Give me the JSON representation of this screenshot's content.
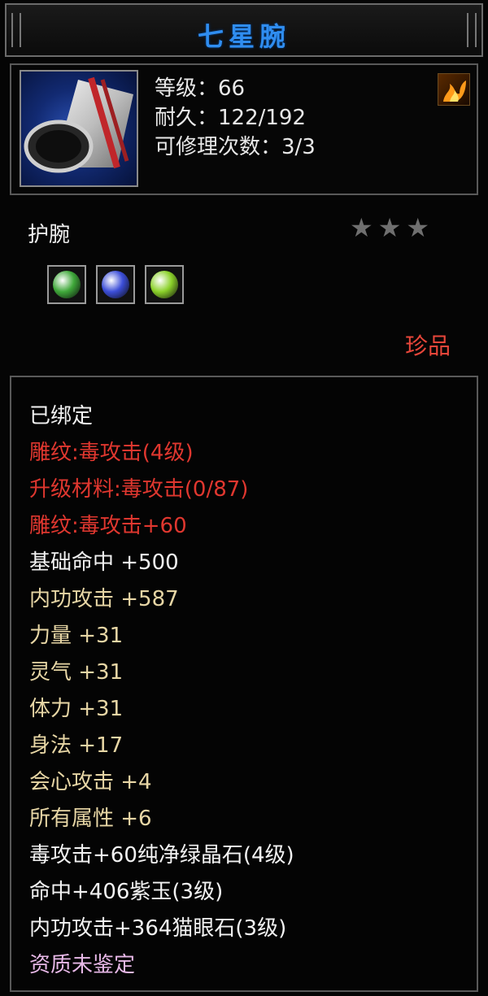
{
  "item": {
    "name": "七星腕",
    "level": "等级：66",
    "durability": "耐久：122/192",
    "repair": "可修理次数：3/3",
    "type": "护腕",
    "quality": "珍品",
    "stars": [
      "★",
      "★",
      "★"
    ],
    "stars_filled": 0,
    "stars_total": 3,
    "gem_colors": [
      "#3fa83a",
      "#3c4ed8",
      "#8bd12a"
    ]
  },
  "attributes": [
    {
      "text": "已绑定",
      "color": "#f2f2f2"
    },
    {
      "text": "雕纹:毒攻击(4级)",
      "color": "#e0372f"
    },
    {
      "text": "升级材料:毒攻击(0/87)",
      "color": "#e0372f"
    },
    {
      "text": "雕纹:毒攻击+60",
      "color": "#e0372f"
    },
    {
      "text": "基础命中 +500",
      "color": "#f2f2f2"
    },
    {
      "text": "内功攻击 +587",
      "color": "#e7d6a5"
    },
    {
      "text": "力量 +31",
      "color": "#e7d6a5"
    },
    {
      "text": "灵气 +31",
      "color": "#e7d6a5"
    },
    {
      "text": "体力 +31",
      "color": "#e7d6a5"
    },
    {
      "text": "身法 +17",
      "color": "#e7d6a5"
    },
    {
      "text": "会心攻击 +4",
      "color": "#e7d6a5"
    },
    {
      "text": "所有属性 +6",
      "color": "#e7d6a5"
    },
    {
      "text": "毒攻击+60纯净绿晶石(4级)",
      "color": "#f2f2f2"
    },
    {
      "text": "命中+406紫玉(3级)",
      "color": "#f2f2f2"
    },
    {
      "text": "内功攻击+364猫眼石(3级)",
      "color": "#f2f2f2"
    },
    {
      "text": "资质未鉴定",
      "color": "#e7b8e7"
    }
  ]
}
